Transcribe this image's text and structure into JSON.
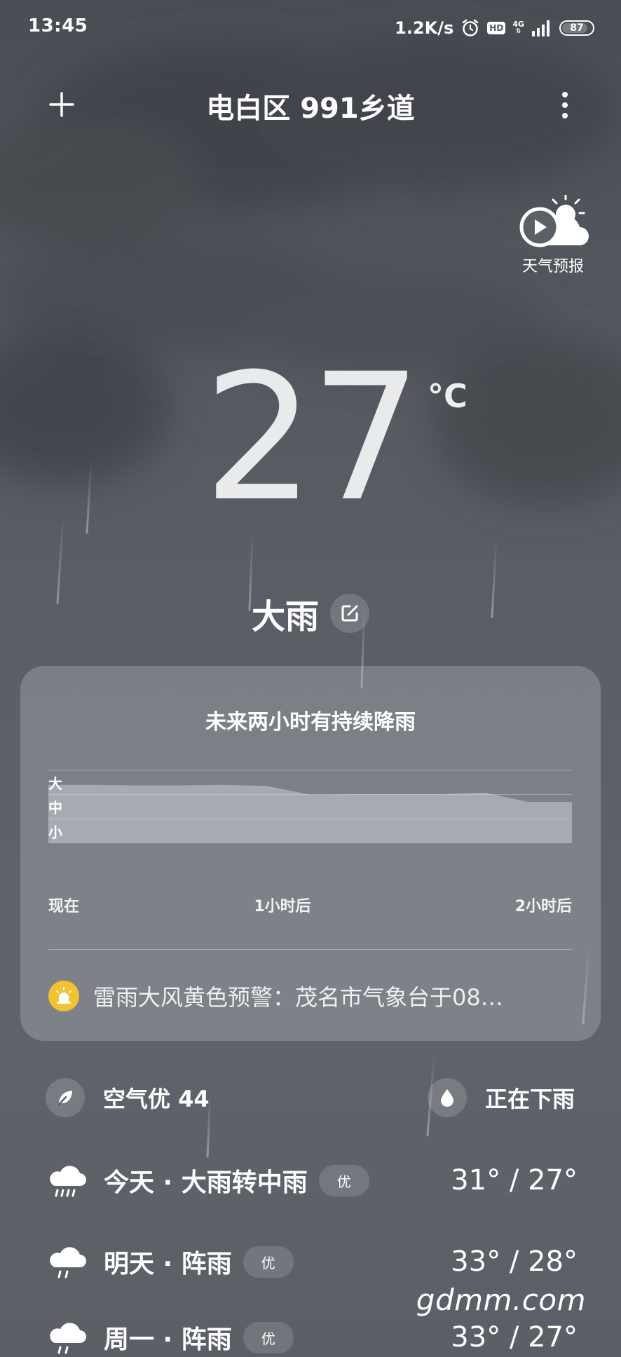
{
  "status_bar": {
    "time": "13:45",
    "net_speed": "1.2K/s",
    "hd": "HD",
    "net_type": "4G",
    "battery": "87"
  },
  "header": {
    "title": "电白区 991乡道"
  },
  "video_forecast": {
    "label": "天气预报"
  },
  "current": {
    "temperature": "27",
    "unit": "°C",
    "condition": "大雨"
  },
  "precip_card": {
    "title": "未来两小时有持续降雨",
    "levels": [
      "大",
      "中",
      "小"
    ],
    "x_labels": [
      "现在",
      "1小时后",
      "2小时后"
    ],
    "alert": "雷雨大风黄色预警：茂名市气象台于08…"
  },
  "chart_data": {
    "type": "area",
    "x": [
      0,
      10,
      20,
      30,
      40,
      50,
      60,
      70,
      80,
      90,
      100,
      110,
      120
    ],
    "values": [
      2.4,
      2.4,
      2.38,
      2.38,
      2.4,
      2.36,
      2.0,
      2.02,
      2.02,
      2.02,
      2.08,
      1.7,
      1.7
    ],
    "ylim": [
      0,
      3
    ],
    "y_tick_labels": [
      "小",
      "中",
      "大"
    ],
    "x_tick_labels": [
      "现在",
      "1小时后",
      "2小时后"
    ]
  },
  "air_quality": {
    "label": "空气优 44"
  },
  "rain_status": {
    "label": "正在下雨"
  },
  "forecast": [
    {
      "label": "今天 · 大雨转中雨",
      "aqi": "优",
      "temp": "31° / 27°",
      "icon": "heavy-rain-cloud-icon"
    },
    {
      "label": "明天 · 阵雨",
      "aqi": "优",
      "temp": "33° / 28°",
      "icon": "shower-cloud-icon"
    },
    {
      "label": "周一 · 阵雨",
      "aqi": "优",
      "temp": "33° / 27°",
      "icon": "shower-cloud-icon"
    }
  ],
  "watermark": "gdmm.com",
  "colors": {
    "background": "#5a5f66",
    "alert_yellow": "#f1c232",
    "card": "#b9bdc3"
  }
}
